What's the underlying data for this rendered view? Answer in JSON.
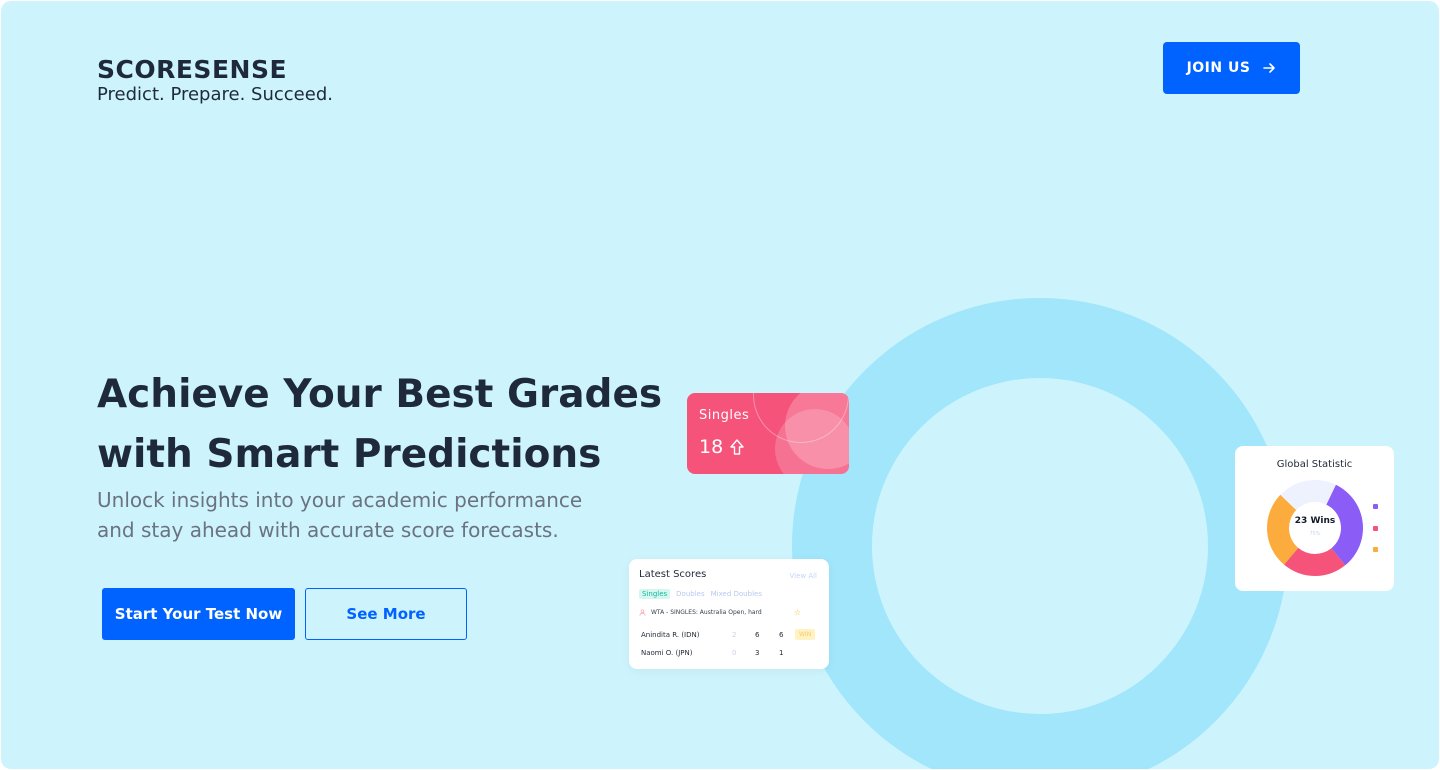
{
  "brand": {
    "name": "SCORESENSE",
    "tagline": "Predict. Prepare. Succeed."
  },
  "header": {
    "join_label": "JOIN US"
  },
  "hero": {
    "title_line1": "Achieve Your Best Grades",
    "title_line2": "with Smart Predictions",
    "subtitle_line1": "Unlock insights into your academic performance",
    "subtitle_line2": "and stay ahead with accurate score forecasts.",
    "primary_cta": "Start Your Test Now",
    "secondary_cta": "See More"
  },
  "singles_card": {
    "label": "Singles",
    "value": "18"
  },
  "scores_card": {
    "title": "Latest Scores",
    "view_all": "View All",
    "tabs": [
      "Singles",
      "Doubles",
      "Mixed Doubles"
    ],
    "event": "WTA - SINGLES: Australia Open, hard",
    "rows": [
      {
        "player": "Anindita R. (IDN)",
        "s0": "2",
        "s1": "6",
        "s2": "6",
        "badge": "WIN"
      },
      {
        "player": "Naomi O. (JPN)",
        "s0": "0",
        "s1": "3",
        "s2": "1",
        "badge": ""
      }
    ]
  },
  "stat_card": {
    "title": "Global Statistic",
    "center": "23 Wins",
    "sub": "75%",
    "segments": [
      {
        "color": "#8b5cf6",
        "fraction": 0.32
      },
      {
        "color": "#f5537a",
        "fraction": 0.22
      },
      {
        "color": "#fbac3c",
        "fraction": 0.26
      },
      {
        "color": "#eef2ff",
        "fraction": 0.2
      }
    ],
    "legend_colors": [
      "#8b5cf6",
      "#f5537a",
      "#fbac3c"
    ]
  },
  "colors": {
    "background": "#cdf4fc",
    "accent": "#0062ff",
    "ring": "#a1e6fb",
    "singles": "#f5537a"
  }
}
